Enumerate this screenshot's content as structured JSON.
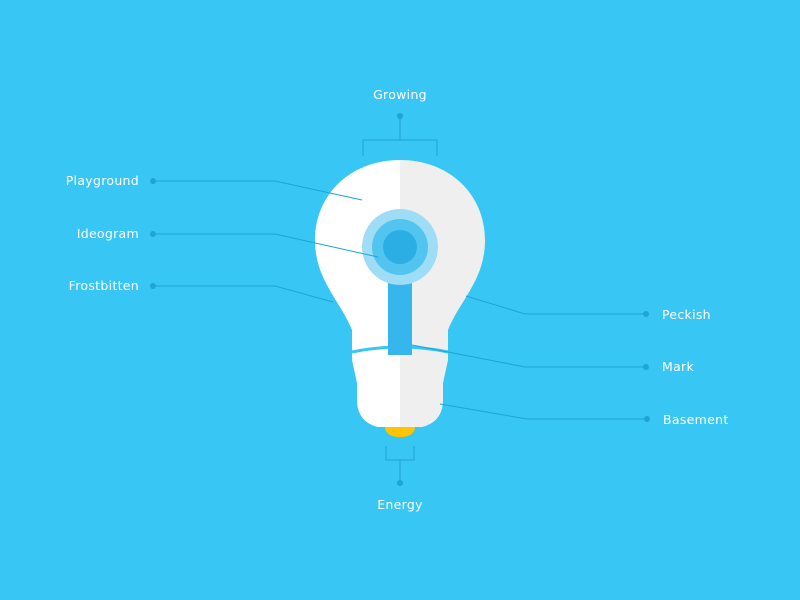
{
  "colors": {
    "background": "#38c6f4",
    "bulb_white": "#ffffff",
    "bulb_shade": "#efefef",
    "accent_blue": "#35b6ec",
    "connector": "#1fa3d8",
    "base_cap": "#ffc300"
  },
  "labels": {
    "top": "Growing",
    "bottom": "Energy",
    "left": [
      "Playground",
      "Ideogram",
      "Frostbitten"
    ],
    "right": [
      "Peckish",
      "Mark",
      "Basement"
    ]
  }
}
